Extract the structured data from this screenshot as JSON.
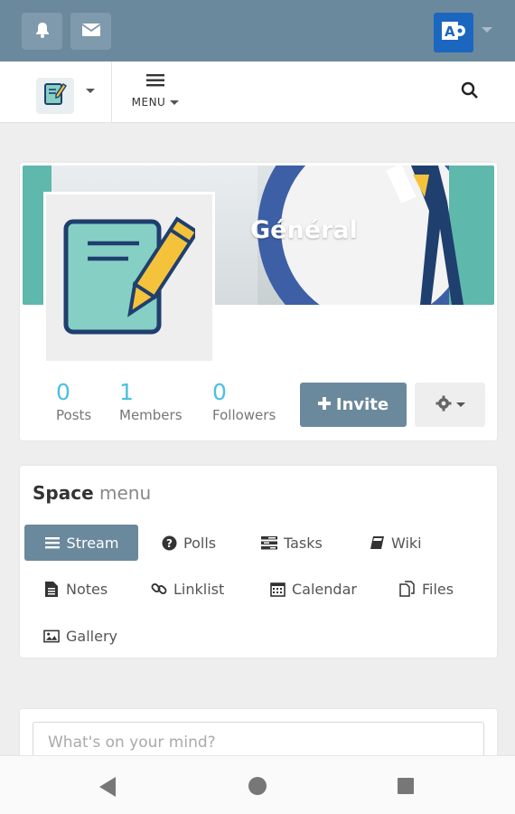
{
  "topbar": {
    "notifications_icon": "bell-icon",
    "messages_icon": "envelope-icon",
    "app_icon": "exchange-icon",
    "accent": "#6b899c"
  },
  "subnav": {
    "space_icon": "notepad-pencil-icon",
    "menu_label": "MENU",
    "search_icon": "search-icon"
  },
  "space": {
    "title": "Général",
    "stats": [
      {
        "value": "0",
        "label": "Posts"
      },
      {
        "value": "1",
        "label": "Members"
      },
      {
        "value": "0",
        "label": "Followers"
      }
    ],
    "invite_label": "Invite",
    "settings_icon": "gear-icon"
  },
  "space_menu": {
    "title_bold": "Space",
    "title_light": "menu",
    "items": [
      {
        "label": "Stream",
        "icon": "bars-icon",
        "active": true
      },
      {
        "label": "Polls",
        "icon": "question-circle-icon"
      },
      {
        "label": "Tasks",
        "icon": "tasks-icon"
      },
      {
        "label": "Wiki",
        "icon": "book-icon"
      },
      {
        "label": "Notes",
        "icon": "file-text-icon"
      },
      {
        "label": "Linklist",
        "icon": "link-icon"
      },
      {
        "label": "Calendar",
        "icon": "calendar-icon"
      },
      {
        "label": "Files",
        "icon": "files-icon"
      },
      {
        "label": "Gallery",
        "icon": "image-icon"
      }
    ]
  },
  "composer": {
    "placeholder": "What's on your mind?"
  },
  "android_nav": {
    "back_icon": "back-triangle-icon",
    "home_icon": "home-circle-icon",
    "recents_icon": "recents-square-icon"
  }
}
